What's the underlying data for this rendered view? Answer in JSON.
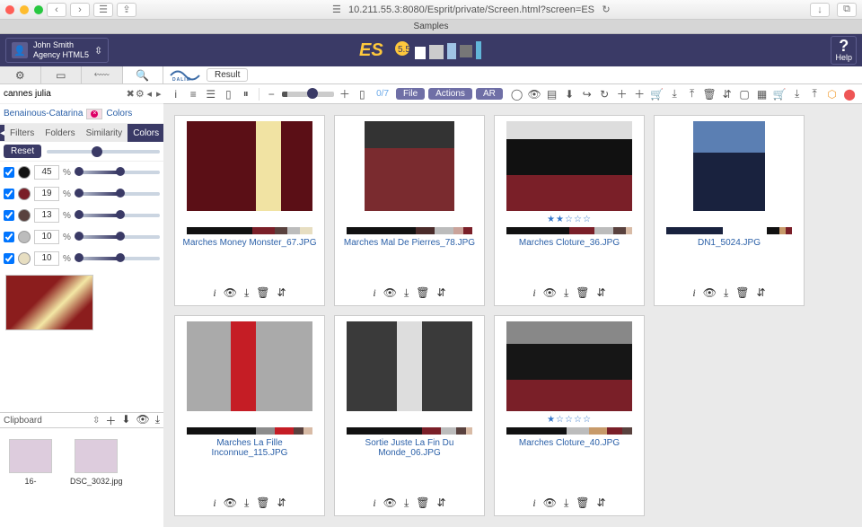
{
  "browser": {
    "url": "10.211.55.3:8080/Esprit/private/Screen.html?screen=ES",
    "tab_title": "Samples"
  },
  "header": {
    "user_name": "John Smith",
    "user_line2": "Agency HTML5",
    "help_label": "Help"
  },
  "left": {
    "search_value": "cannes julia",
    "chip_label": "Benainous-Catarina",
    "colors_label": "Colors",
    "subtabs": {
      "filters": "Filters",
      "folders": "Folders",
      "similarity": "Similarity",
      "colors": "Colors"
    },
    "reset_label": "Reset",
    "color_rows": [
      {
        "hex": "#111111",
        "value": "45"
      },
      {
        "hex": "#7a1f28",
        "value": "19"
      },
      {
        "hex": "#59413e",
        "value": "13"
      },
      {
        "hex": "#bcbcbc",
        "value": "10"
      },
      {
        "hex": "#e7dec1",
        "value": "10"
      }
    ],
    "clipboard_label": "Clipboard",
    "clips": [
      {
        "name": "16-"
      },
      {
        "name": "DSC_3032.jpg"
      }
    ]
  },
  "main": {
    "result_label": "Result",
    "counter": "0/7",
    "pills": {
      "file": "File",
      "actions": "Actions",
      "ar": "AR"
    },
    "cards": [
      {
        "filename": "Marches Money Monster_67.JPG",
        "stars": 0,
        "thumb": "redcarpet1",
        "swatches": [
          [
            "#111",
            52
          ],
          [
            "#7a1f28",
            18
          ],
          [
            "#59413e",
            10
          ],
          [
            "#bcbcbc",
            10
          ],
          [
            "#e7dec1",
            10
          ]
        ]
      },
      {
        "filename": "Marches Mal De Pierres_78.JPG",
        "stars": 0,
        "thumb": "redcarpet2",
        "swatches": [
          [
            "#111",
            55
          ],
          [
            "#4a2b2a",
            15
          ],
          [
            "#bcbcbc",
            15
          ],
          [
            "#caa39a",
            8
          ],
          [
            "#7a1f28",
            7
          ]
        ]
      },
      {
        "filename": "Marches Cloture_36.JPG",
        "stars": 2,
        "thumb": "redcarpet3",
        "swatches": [
          [
            "#111",
            50
          ],
          [
            "#7a1f28",
            20
          ],
          [
            "#bcbcbc",
            15
          ],
          [
            "#59413e",
            10
          ],
          [
            "#d8bba6",
            5
          ]
        ]
      },
      {
        "filename": "DN1_5024.JPG",
        "stars": 0,
        "thumb": "bluesuit",
        "swatches": [
          [
            "#19223e",
            45
          ],
          [
            "#ffffff",
            35
          ],
          [
            "#111",
            10
          ],
          [
            "#c79a6a",
            5
          ],
          [
            "#7a1f28",
            5
          ]
        ]
      },
      {
        "filename": "Marches La Fille Inconnue_115.JPG",
        "stars": 0,
        "thumb": "reddress",
        "swatches": [
          [
            "#111",
            55
          ],
          [
            "#8c8c8c",
            15
          ],
          [
            "#c51d25",
            15
          ],
          [
            "#59413e",
            8
          ],
          [
            "#d8bba6",
            7
          ]
        ]
      },
      {
        "filename": "Sortie Juste La Fin Du Monde_06.JPG",
        "stars": 0,
        "thumb": "bwdress",
        "swatches": [
          [
            "#111",
            60
          ],
          [
            "#7a1f28",
            15
          ],
          [
            "#bcbcbc",
            12
          ],
          [
            "#59413e",
            8
          ],
          [
            "#d8bba6",
            5
          ]
        ]
      },
      {
        "filename": "Marches Cloture_40.JPG",
        "stars": 1,
        "thumb": "tux",
        "swatches": [
          [
            "#111",
            48
          ],
          [
            "#bcbcbc",
            18
          ],
          [
            "#c79a6a",
            14
          ],
          [
            "#7a1f28",
            12
          ],
          [
            "#59413e",
            8
          ]
        ]
      }
    ]
  }
}
